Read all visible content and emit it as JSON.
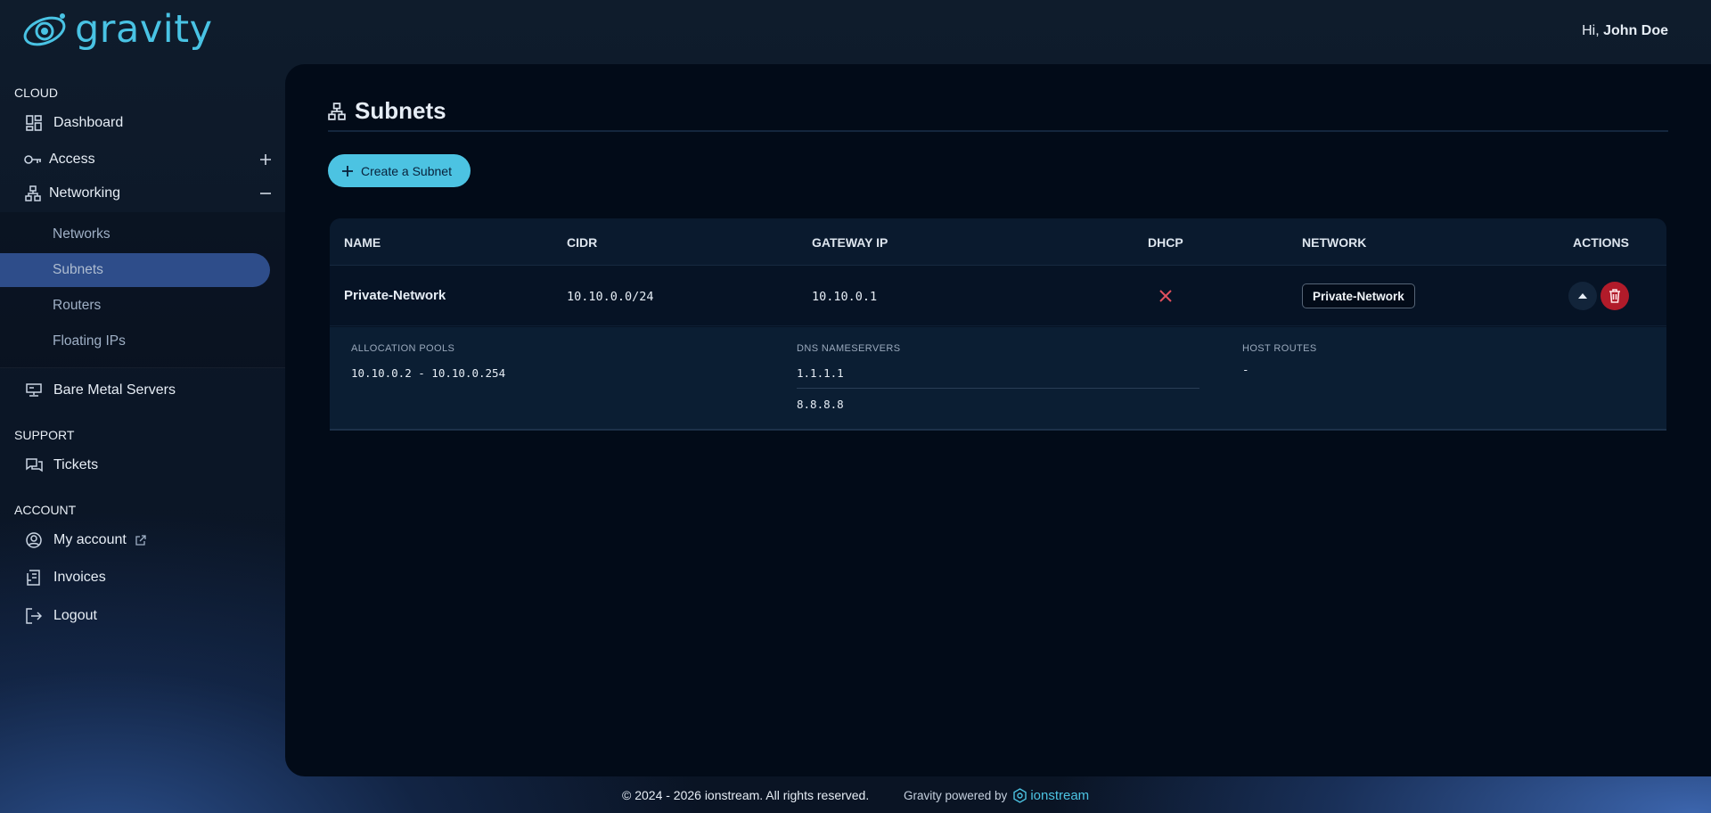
{
  "app": {
    "name": "gravity"
  },
  "header": {
    "greeting": "Hi,",
    "user_name": "John Doe"
  },
  "sidebar": {
    "cloud": {
      "title": "CLOUD",
      "dashboard": "Dashboard",
      "access": "Access",
      "networking": "Networking",
      "networking_sub": [
        "Networks",
        "Subnets",
        "Routers",
        "Floating IPs"
      ],
      "bare_metal": "Bare Metal Servers"
    },
    "support": {
      "title": "SUPPORT",
      "tickets": "Tickets"
    },
    "account": {
      "title": "ACCOUNT",
      "my_account": "My account",
      "invoices": "Invoices",
      "logout": "Logout"
    }
  },
  "page": {
    "title": "Subnets",
    "create_button": "Create a Subnet",
    "table": {
      "headers": [
        "NAME",
        "CIDR",
        "GATEWAY IP",
        "DHCP",
        "NETWORK",
        "ACTIONS"
      ],
      "rows": [
        {
          "name": "Private-Network",
          "cidr": "10.10.0.0/24",
          "gateway": "10.10.0.1",
          "dhcp": "disabled",
          "network": "Private-Network"
        }
      ],
      "details": {
        "allocation_pools_label": "ALLOCATION POOLS",
        "allocation_pools": "10.10.0.2 - 10.10.0.254",
        "dns_label": "DNS NAMESERVERS",
        "dns": [
          "1.1.1.1",
          "8.8.8.8"
        ],
        "host_routes_label": "HOST ROUTES",
        "host_routes": "-"
      }
    }
  },
  "footer": {
    "copyright": "© 2024 - 2026 ionstream. All rights reserved.",
    "powered_by": "Gravity powered by",
    "brand": "ionstream"
  },
  "colors": {
    "accent": "#4cc3e2",
    "active_nav": "#2e4d8a",
    "delete": "#b11b2a",
    "dhcp_off": "#e0505e"
  }
}
